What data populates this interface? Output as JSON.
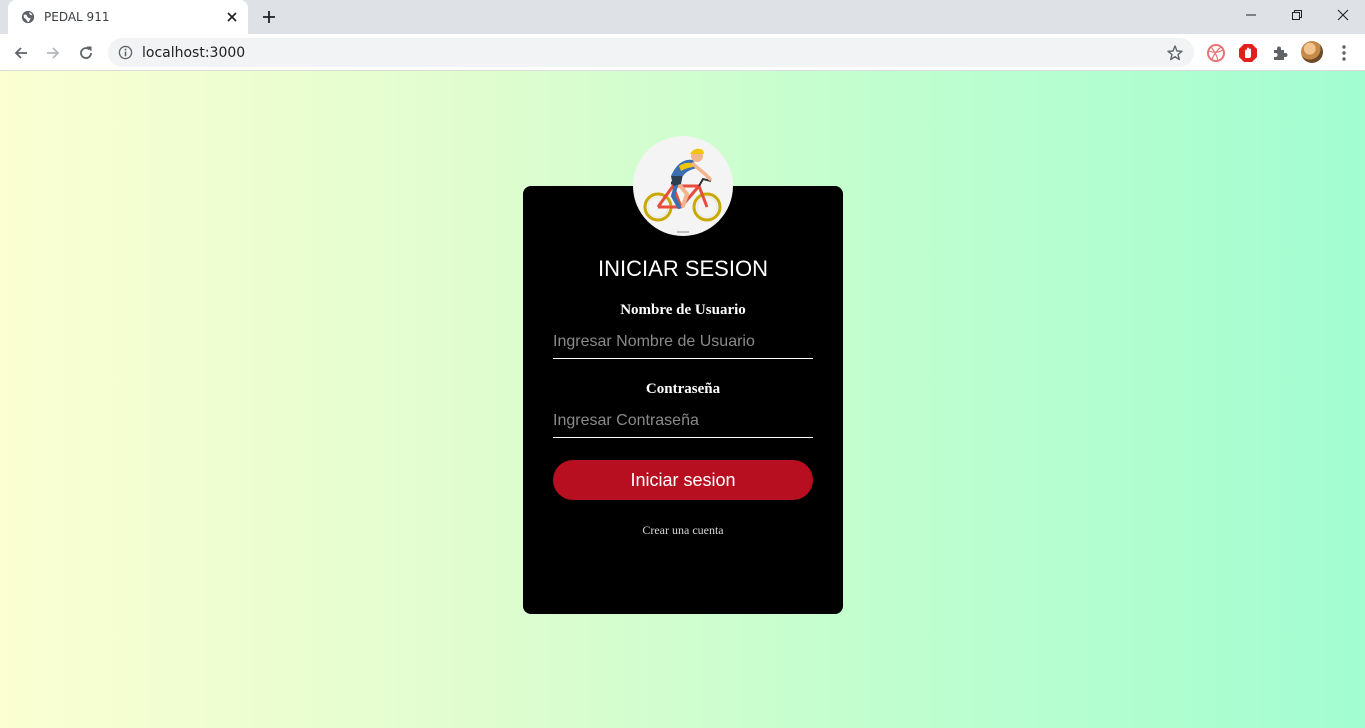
{
  "browser": {
    "tab_title": "PEDAL 911",
    "url": "localhost:3000"
  },
  "login": {
    "title": "INICIAR SESION",
    "username_label": "Nombre de Usuario",
    "username_placeholder": "Ingresar Nombre de Usuario",
    "username_value": "",
    "password_label": "Contraseña",
    "password_placeholder": "Ingresar Contraseña",
    "password_value": "",
    "submit_label": "Iniciar sesion",
    "signup_link": "Crear una cuenta"
  },
  "colors": {
    "card_background": "#000000",
    "button_background": "#b80f20",
    "page_gradient_start": "#fbffd2",
    "page_gradient_end": "#a2fdd1"
  },
  "icons": {
    "tab_favicon": "globe-icon",
    "logo": "cyclist-logo"
  }
}
